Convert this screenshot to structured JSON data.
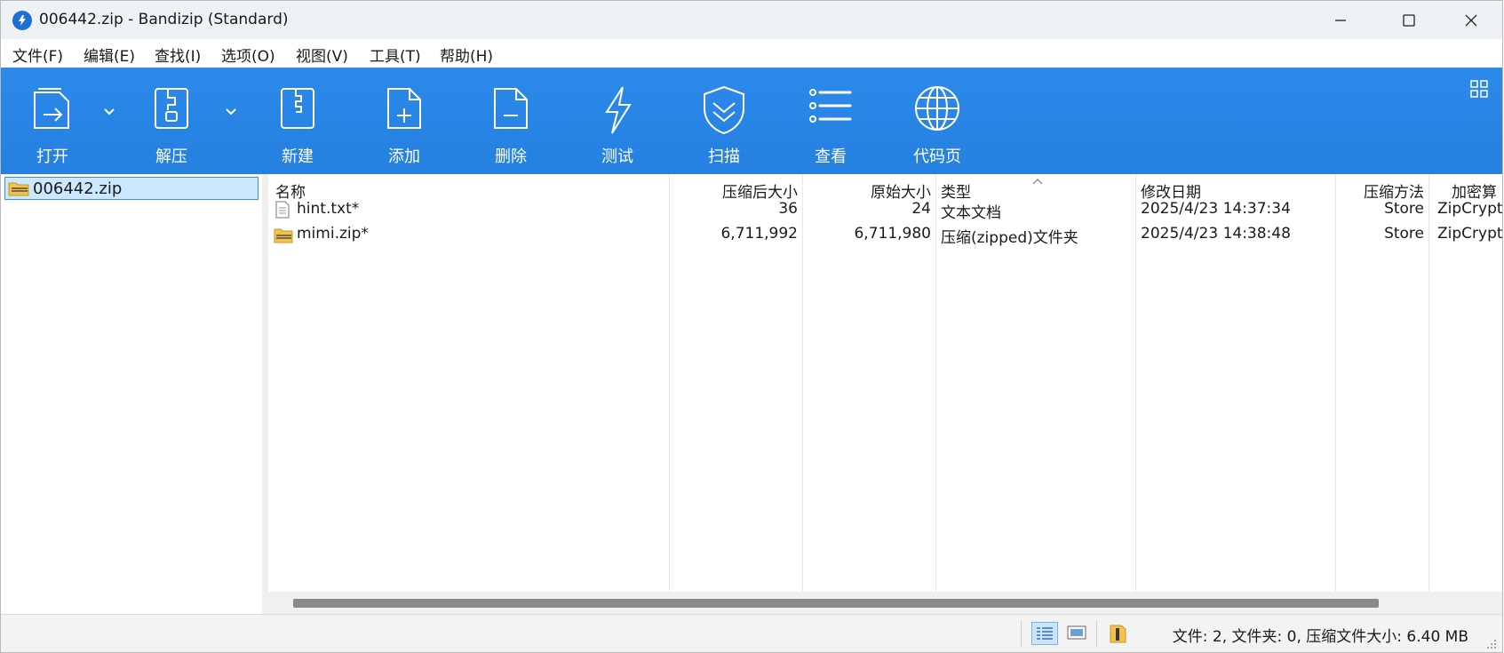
{
  "window": {
    "title": "006442.zip - Bandizip (Standard)"
  },
  "menu": [
    "文件(F)",
    "编辑(E)",
    "查找(I)",
    "选项(O)",
    "视图(V)",
    "工具(T)",
    "帮助(H)"
  ],
  "toolbar": {
    "open": "打开",
    "extract": "解压",
    "new": "新建",
    "add": "添加",
    "delete": "删除",
    "test": "测试",
    "scan": "扫描",
    "view": "查看",
    "codepage": "代码页"
  },
  "tree": {
    "root": "006442.zip"
  },
  "columns": {
    "name": "名称",
    "packed": "压缩后大小",
    "original": "原始大小",
    "type": "类型",
    "modified": "修改日期",
    "method": "压缩方法",
    "encryption": "加密算"
  },
  "files": [
    {
      "name": "hint.txt*",
      "packed": "36",
      "original": "24",
      "type": "文本文档",
      "modified": "2025/4/23 14:37:34",
      "method": "Store",
      "encryption": "ZipCrypt",
      "icon": "text-file-icon"
    },
    {
      "name": "mimi.zip*",
      "packed": "6,711,992",
      "original": "6,711,980",
      "type": "压缩(zipped)文件夹",
      "modified": "2025/4/23 14:38:48",
      "method": "Store",
      "encryption": "ZipCrypt",
      "icon": "zip-file-icon"
    }
  ],
  "status": {
    "summary": "文件: 2, 文件夹: 0, 压缩文件大小: 6.40 MB"
  },
  "colors": {
    "toolbar": "#2a86e6",
    "selection": "#cce8ff",
    "accent": "#1d6fd1"
  }
}
